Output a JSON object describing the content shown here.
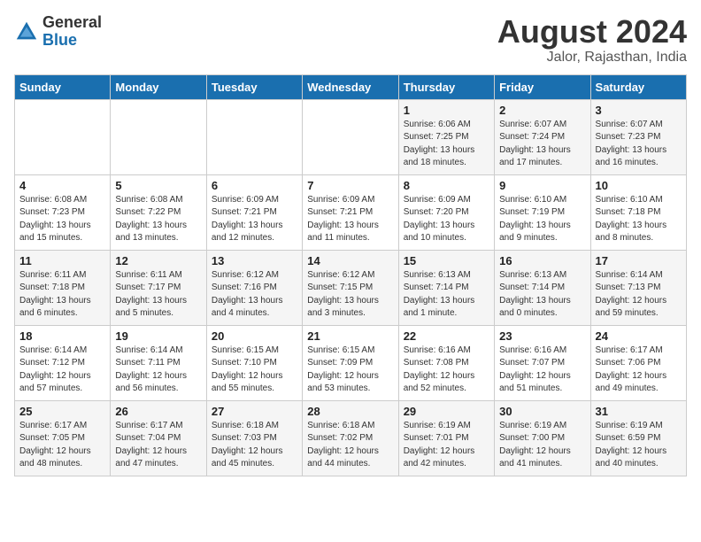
{
  "header": {
    "logo_general": "General",
    "logo_blue": "Blue",
    "month_title": "August 2024",
    "location": "Jalor, Rajasthan, India"
  },
  "days_of_week": [
    "Sunday",
    "Monday",
    "Tuesday",
    "Wednesday",
    "Thursday",
    "Friday",
    "Saturday"
  ],
  "weeks": [
    [
      {
        "day": "",
        "info": ""
      },
      {
        "day": "",
        "info": ""
      },
      {
        "day": "",
        "info": ""
      },
      {
        "day": "",
        "info": ""
      },
      {
        "day": "1",
        "info": "Sunrise: 6:06 AM\nSunset: 7:25 PM\nDaylight: 13 hours\nand 18 minutes."
      },
      {
        "day": "2",
        "info": "Sunrise: 6:07 AM\nSunset: 7:24 PM\nDaylight: 13 hours\nand 17 minutes."
      },
      {
        "day": "3",
        "info": "Sunrise: 6:07 AM\nSunset: 7:23 PM\nDaylight: 13 hours\nand 16 minutes."
      }
    ],
    [
      {
        "day": "4",
        "info": "Sunrise: 6:08 AM\nSunset: 7:23 PM\nDaylight: 13 hours\nand 15 minutes."
      },
      {
        "day": "5",
        "info": "Sunrise: 6:08 AM\nSunset: 7:22 PM\nDaylight: 13 hours\nand 13 minutes."
      },
      {
        "day": "6",
        "info": "Sunrise: 6:09 AM\nSunset: 7:21 PM\nDaylight: 13 hours\nand 12 minutes."
      },
      {
        "day": "7",
        "info": "Sunrise: 6:09 AM\nSunset: 7:21 PM\nDaylight: 13 hours\nand 11 minutes."
      },
      {
        "day": "8",
        "info": "Sunrise: 6:09 AM\nSunset: 7:20 PM\nDaylight: 13 hours\nand 10 minutes."
      },
      {
        "day": "9",
        "info": "Sunrise: 6:10 AM\nSunset: 7:19 PM\nDaylight: 13 hours\nand 9 minutes."
      },
      {
        "day": "10",
        "info": "Sunrise: 6:10 AM\nSunset: 7:18 PM\nDaylight: 13 hours\nand 8 minutes."
      }
    ],
    [
      {
        "day": "11",
        "info": "Sunrise: 6:11 AM\nSunset: 7:18 PM\nDaylight: 13 hours\nand 6 minutes."
      },
      {
        "day": "12",
        "info": "Sunrise: 6:11 AM\nSunset: 7:17 PM\nDaylight: 13 hours\nand 5 minutes."
      },
      {
        "day": "13",
        "info": "Sunrise: 6:12 AM\nSunset: 7:16 PM\nDaylight: 13 hours\nand 4 minutes."
      },
      {
        "day": "14",
        "info": "Sunrise: 6:12 AM\nSunset: 7:15 PM\nDaylight: 13 hours\nand 3 minutes."
      },
      {
        "day": "15",
        "info": "Sunrise: 6:13 AM\nSunset: 7:14 PM\nDaylight: 13 hours\nand 1 minute."
      },
      {
        "day": "16",
        "info": "Sunrise: 6:13 AM\nSunset: 7:14 PM\nDaylight: 13 hours\nand 0 minutes."
      },
      {
        "day": "17",
        "info": "Sunrise: 6:14 AM\nSunset: 7:13 PM\nDaylight: 12 hours\nand 59 minutes."
      }
    ],
    [
      {
        "day": "18",
        "info": "Sunrise: 6:14 AM\nSunset: 7:12 PM\nDaylight: 12 hours\nand 57 minutes."
      },
      {
        "day": "19",
        "info": "Sunrise: 6:14 AM\nSunset: 7:11 PM\nDaylight: 12 hours\nand 56 minutes."
      },
      {
        "day": "20",
        "info": "Sunrise: 6:15 AM\nSunset: 7:10 PM\nDaylight: 12 hours\nand 55 minutes."
      },
      {
        "day": "21",
        "info": "Sunrise: 6:15 AM\nSunset: 7:09 PM\nDaylight: 12 hours\nand 53 minutes."
      },
      {
        "day": "22",
        "info": "Sunrise: 6:16 AM\nSunset: 7:08 PM\nDaylight: 12 hours\nand 52 minutes."
      },
      {
        "day": "23",
        "info": "Sunrise: 6:16 AM\nSunset: 7:07 PM\nDaylight: 12 hours\nand 51 minutes."
      },
      {
        "day": "24",
        "info": "Sunrise: 6:17 AM\nSunset: 7:06 PM\nDaylight: 12 hours\nand 49 minutes."
      }
    ],
    [
      {
        "day": "25",
        "info": "Sunrise: 6:17 AM\nSunset: 7:05 PM\nDaylight: 12 hours\nand 48 minutes."
      },
      {
        "day": "26",
        "info": "Sunrise: 6:17 AM\nSunset: 7:04 PM\nDaylight: 12 hours\nand 47 minutes."
      },
      {
        "day": "27",
        "info": "Sunrise: 6:18 AM\nSunset: 7:03 PM\nDaylight: 12 hours\nand 45 minutes."
      },
      {
        "day": "28",
        "info": "Sunrise: 6:18 AM\nSunset: 7:02 PM\nDaylight: 12 hours\nand 44 minutes."
      },
      {
        "day": "29",
        "info": "Sunrise: 6:19 AM\nSunset: 7:01 PM\nDaylight: 12 hours\nand 42 minutes."
      },
      {
        "day": "30",
        "info": "Sunrise: 6:19 AM\nSunset: 7:00 PM\nDaylight: 12 hours\nand 41 minutes."
      },
      {
        "day": "31",
        "info": "Sunrise: 6:19 AM\nSunset: 6:59 PM\nDaylight: 12 hours\nand 40 minutes."
      }
    ]
  ]
}
